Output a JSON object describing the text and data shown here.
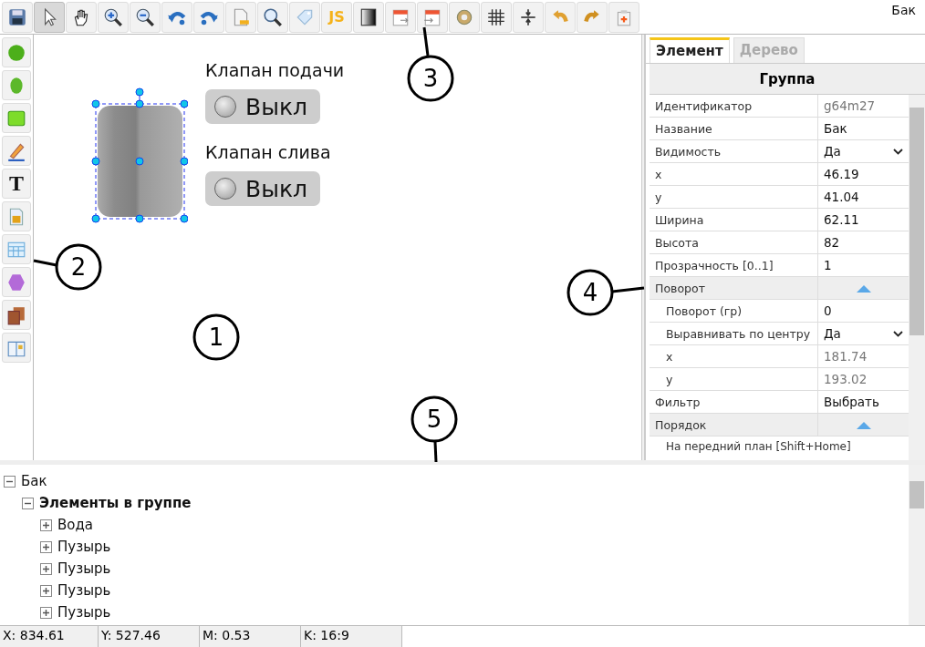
{
  "toolbar": {
    "buttons": [
      {
        "kind": "icon",
        "selected": false
      },
      {
        "kind": "icon",
        "selected": true
      },
      {
        "kind": "icon",
        "selected": false
      },
      {
        "kind": "icon",
        "selected": false
      },
      {
        "kind": "icon",
        "selected": false
      },
      {
        "kind": "icon",
        "selected": false
      },
      {
        "kind": "icon",
        "selected": false
      },
      {
        "kind": "icon",
        "selected": false
      },
      {
        "kind": "icon",
        "selected": false
      },
      {
        "kind": "icon",
        "selected": false
      },
      {
        "kind": "glyph",
        "label": "JS",
        "selected": false
      },
      {
        "kind": "icon",
        "selected": false
      },
      {
        "kind": "icon",
        "selected": false
      },
      {
        "kind": "icon",
        "selected": false
      },
      {
        "kind": "icon",
        "selected": false
      },
      {
        "kind": "icon",
        "selected": false
      },
      {
        "kind": "icon",
        "selected": false
      },
      {
        "kind": "icon",
        "selected": false
      },
      {
        "kind": "icon",
        "selected": false
      },
      {
        "kind": "icon",
        "selected": false
      }
    ],
    "title": "Бак"
  },
  "tools": [
    {
      "kind": "icon"
    },
    {
      "kind": "icon"
    },
    {
      "kind": "icon"
    },
    {
      "kind": "icon"
    },
    {
      "kind": "glyph",
      "label": "T"
    },
    {
      "kind": "icon"
    },
    {
      "kind": "icon"
    },
    {
      "kind": "icon"
    },
    {
      "kind": "icon"
    },
    {
      "kind": "icon"
    }
  ],
  "canvas": {
    "valves": [
      {
        "label": "Клапан подачи",
        "state": "Выкл",
        "on": false
      },
      {
        "label": "Клапан слива",
        "state": "Выкл",
        "on": false
      }
    ]
  },
  "callouts": [
    "1",
    "2",
    "3",
    "4",
    "5"
  ],
  "panel": {
    "tabs": [
      {
        "label": "Элемент",
        "selected": true
      },
      {
        "label": "Дерево",
        "selected": false
      }
    ],
    "header": "Группа",
    "properties": [
      {
        "kind": "text",
        "name": "Идентификатор",
        "value": "g64m27",
        "disabled": true
      },
      {
        "kind": "text",
        "name": "Название",
        "value": "Бак",
        "disabled": false
      },
      {
        "kind": "select",
        "name": "Видимость",
        "value": "Да",
        "disabled": false
      },
      {
        "kind": "text",
        "name": "x",
        "value": "46.19",
        "disabled": false
      },
      {
        "kind": "text",
        "name": "y",
        "value": "41.04",
        "disabled": false
      },
      {
        "kind": "text",
        "name": "Ширина",
        "value": "62.11",
        "disabled": false
      },
      {
        "kind": "text",
        "name": "Высота",
        "value": "82",
        "disabled": false
      },
      {
        "kind": "text",
        "name": "Прозрачность [0..1]",
        "value": "1",
        "disabled": false
      },
      {
        "kind": "section",
        "name": "Поворот",
        "expanded": true,
        "children": [
          {
            "kind": "text",
            "name": "Поворот (гр)",
            "value": "0",
            "disabled": false
          },
          {
            "kind": "select",
            "name": "Выравнивать по центру",
            "value": "Да",
            "disabled": false
          },
          {
            "kind": "text",
            "name": "x",
            "value": "181.74",
            "disabled": true
          },
          {
            "kind": "text",
            "name": "y",
            "value": "193.02",
            "disabled": true
          }
        ]
      },
      {
        "kind": "text",
        "name": "Фильтр",
        "value": "Выбрать",
        "disabled": false
      },
      {
        "kind": "section",
        "name": "Порядок",
        "expanded": true,
        "children": [
          {
            "kind": "action",
            "name": "На передний план [Shift+Home]"
          }
        ]
      }
    ]
  },
  "tree": [
    {
      "label": "Бак",
      "bold": false,
      "expanded": true,
      "children": [
        {
          "label": "Элементы в группе",
          "bold": true,
          "expanded": true,
          "children": [
            {
              "label": "Вода",
              "bold": false,
              "expanded": false
            },
            {
              "label": "Пузырь",
              "bold": false,
              "expanded": false
            },
            {
              "label": "Пузырь",
              "bold": false,
              "expanded": false
            },
            {
              "label": "Пузырь",
              "bold": false,
              "expanded": false
            },
            {
              "label": "Пузырь",
              "bold": false,
              "expanded": false
            }
          ]
        }
      ]
    }
  ],
  "status_bar": [
    "X: 834.61",
    "Y: 527.46",
    "M: 0.53",
    "K: 16:9"
  ]
}
